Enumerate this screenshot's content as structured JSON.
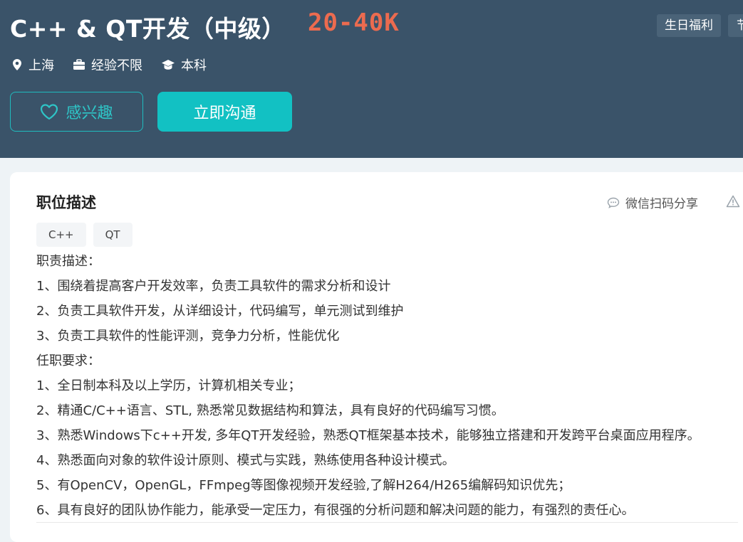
{
  "job": {
    "title": "C++ & QT开发（中级）",
    "salary": "20-40K",
    "benefits": [
      "生日福利",
      "节"
    ],
    "location": "上海",
    "experience": "经验不限",
    "education": "本科"
  },
  "actions": {
    "interest_label": "感兴趣",
    "chat_label": "立即沟通"
  },
  "detail": {
    "section_title": "职位描述",
    "share_label": "微信扫码分享",
    "skills": [
      "C++",
      "QT"
    ],
    "lines": [
      "职责描述：",
      "1、围绕着提高客户开发效率，负责工具软件的需求分析和设计",
      "2、负责工具软件开发，从详细设计，代码编写，单元测试到维护",
      "3、负责工具软件的性能评测，竞争力分析，性能优化",
      "任职要求：",
      "1、全日制本科及以上学历，计算机相关专业；",
      "2、精通C/C++语言、STL, 熟悉常见数据结构和算法，具有良好的代码编写习惯。",
      "3、熟悉Windows下c++开发, 多年QT开发经验，熟悉QT框架基本技术，能够独立搭建和开发跨平台桌面应用程序。",
      "4、熟悉面向对象的软件设计原则、模式与实践，熟练使用各种设计模式。",
      "5、有OpenCV，OpenGL，FFmpeg等图像视频开发经验,了解H264/H265编解码知识优先；",
      "6、具有良好的团队协作能力，能承受一定压力，有很强的分析问题和解决问题的能力，有强烈的责任心。"
    ]
  },
  "colors": {
    "header_bg": "#3a5369",
    "salary": "#ec6b4f",
    "accent": "#12c1c3"
  },
  "icons": {
    "location": "location-pin-icon",
    "experience": "briefcase-icon",
    "education": "graduation-cap-icon",
    "interest": "heart-outline-icon",
    "share": "chat-bubble-icon",
    "report": "warning-triangle-icon"
  }
}
